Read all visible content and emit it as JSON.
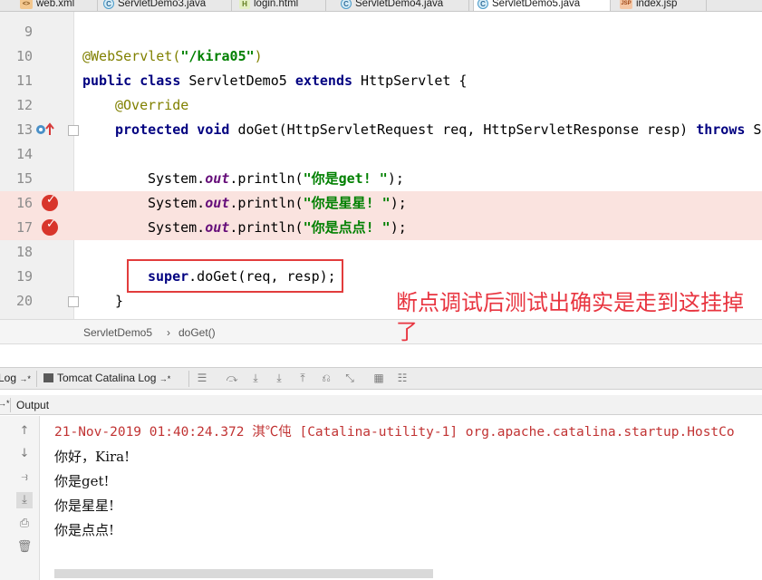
{
  "tabs": [
    {
      "label": "web.xml",
      "icon": "xml-file-icon"
    },
    {
      "label": "ServletDemo3.java",
      "icon": "java-class-icon"
    },
    {
      "label": "login.html",
      "icon": "html-file-icon"
    },
    {
      "label": "ServletDemo4.java",
      "icon": "java-class-icon"
    },
    {
      "label": "ServletDemo5.java",
      "icon": "java-class-icon",
      "active": true
    },
    {
      "label": "index.jsp",
      "icon": "jsp-file-icon"
    }
  ],
  "editor": {
    "line_numbers": [
      "9",
      "10",
      "11",
      "12",
      "13",
      "14",
      "15",
      "16",
      "17",
      "18",
      "19",
      "20"
    ],
    "line10": {
      "annotation": "@WebServlet(",
      "path": "\"/kira05\"",
      "close": ")"
    },
    "line11": {
      "kw1": "public class",
      "name": " ServletDemo5 ",
      "kw2": "extends",
      "rest": " HttpServlet {"
    },
    "line12": "@Override",
    "line13": {
      "kw": "protected void",
      "rest": " doGet(HttpServletRequest req, HttpServletResponse resp) ",
      "throws": "throws",
      "tail": " Se"
    },
    "line15": {
      "pre": "System.",
      "field": "out",
      "mid": ".println(",
      "str": "\"你是get! \"",
      "end": ");"
    },
    "line16": {
      "pre": "System.",
      "field": "out",
      "mid": ".println(",
      "str": "\"你是星星! \"",
      "end": ");"
    },
    "line17": {
      "pre": "System.",
      "field": "out",
      "mid": ".println(",
      "str": "\"你是点点! \"",
      "end": ");"
    },
    "line19": {
      "kw": "super",
      "rest": ".doGet(req, resp);"
    },
    "line20": "}"
  },
  "annotation_note": "断点调试后测试出确实是走到这挂掉了",
  "breadcrumb": {
    "class": "ServletDemo5",
    "sep": "›",
    "method": "doGet()"
  },
  "logbar": {
    "left_tab": "Log",
    "left_pin": "→*",
    "tab": "Tomcat Catalina Log",
    "tab_pin": "→*"
  },
  "output": {
    "pin": "→*",
    "title": "Output",
    "lines": [
      "21-Nov-2019 01:40:24.372 淇℃伅 [Catalina-utility-1] org.apache.catalina.startup.HostCo",
      "你好，Kira!",
      "你是get!",
      "你是星星!",
      "你是点点!"
    ]
  },
  "colors": {
    "breakpoint": "#d8352b",
    "highlight": "#fae3df",
    "annotation": "#e8343f",
    "keyword": "#000080",
    "string": "#008000"
  }
}
